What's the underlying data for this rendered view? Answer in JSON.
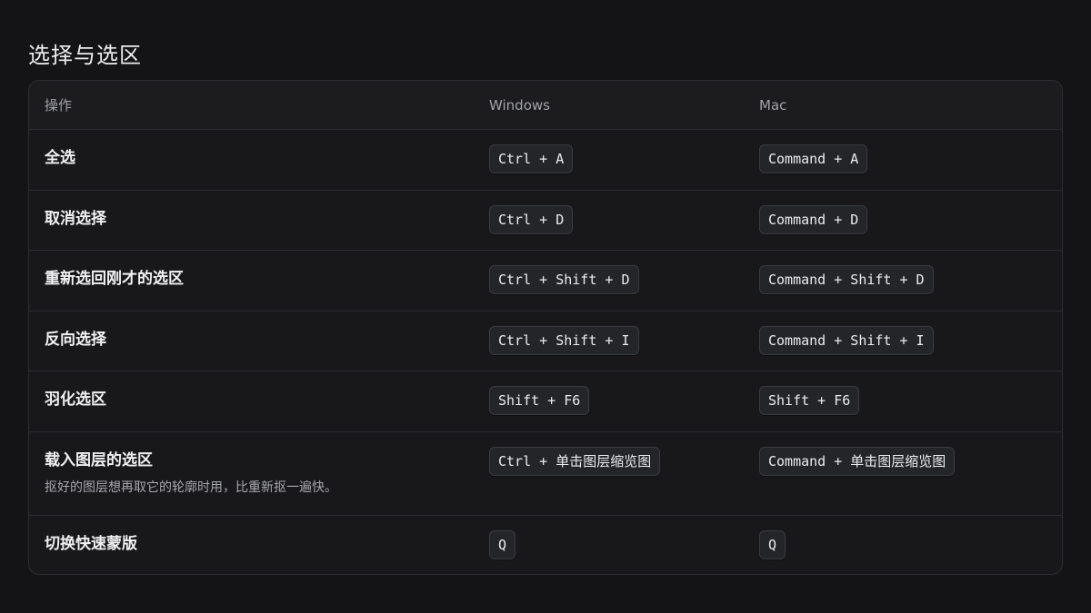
{
  "section": {
    "title": "选择与选区"
  },
  "table": {
    "headers": {
      "action": "操作",
      "windows": "Windows",
      "mac": "Mac"
    },
    "rows": [
      {
        "action": "全选",
        "description": "",
        "windows": "Ctrl + A",
        "mac": "Command + A"
      },
      {
        "action": "取消选择",
        "description": "",
        "windows": "Ctrl + D",
        "mac": "Command + D"
      },
      {
        "action": "重新选回刚才的选区",
        "description": "",
        "windows": "Ctrl + Shift + D",
        "mac": "Command + Shift + D"
      },
      {
        "action": "反向选择",
        "description": "",
        "windows": "Ctrl + Shift + I",
        "mac": "Command + Shift + I"
      },
      {
        "action": "羽化选区",
        "description": "",
        "windows": "Shift + F6",
        "mac": "Shift + F6"
      },
      {
        "action": "载入图层的选区",
        "description": "抠好的图层想再取它的轮廓时用，比重新抠一遍快。",
        "windows": "Ctrl + 单击图层缩览图",
        "mac": "Command + 单击图层缩览图"
      },
      {
        "action": "切换快速蒙版",
        "description": "",
        "windows": "Q",
        "mac": "Q"
      }
    ]
  }
}
